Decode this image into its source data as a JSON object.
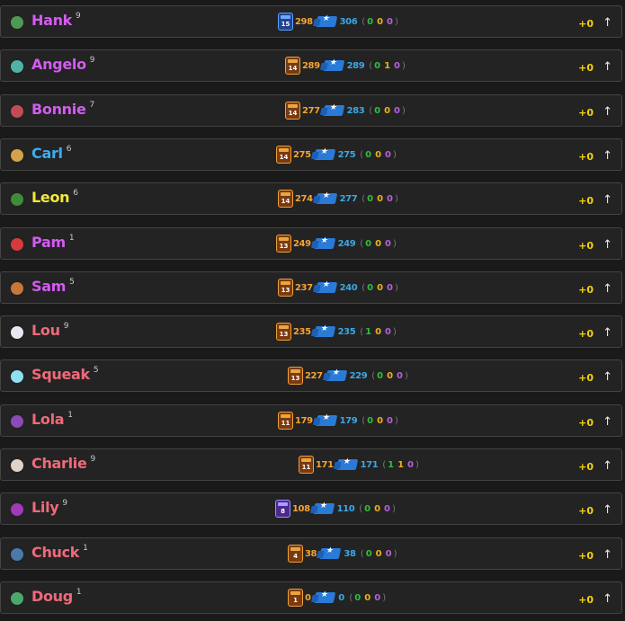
{
  "gain_color": "#f4d20a",
  "paren_colors": [
    "#2fbf3c",
    "#e8b21a",
    "#b660e0"
  ],
  "arrow_icon": "↑",
  "brawlers": [
    {
      "name": "Hank",
      "level": "9",
      "name_color": "#d25cf0",
      "avatar_color": "#4e9a55",
      "rank": "15",
      "trophies": "298",
      "max_trophies": "306",
      "stats": [
        "0",
        "0",
        "0"
      ],
      "gain": "+0"
    },
    {
      "name": "Angelo",
      "level": "9",
      "name_color": "#d25cf0",
      "avatar_color": "#4fb3a6",
      "rank": "14",
      "trophies": "289",
      "max_trophies": "289",
      "stats": [
        "0",
        "1",
        "0"
      ],
      "gain": "+0"
    },
    {
      "name": "Bonnie",
      "level": "7",
      "name_color": "#d25cf0",
      "avatar_color": "#c24b5a",
      "rank": "14",
      "trophies": "277",
      "max_trophies": "283",
      "stats": [
        "0",
        "0",
        "0"
      ],
      "gain": "+0"
    },
    {
      "name": "Carl",
      "level": "6",
      "name_color": "#3aaef0",
      "avatar_color": "#d3a24a",
      "rank": "14",
      "trophies": "275",
      "max_trophies": "275",
      "stats": [
        "0",
        "0",
        "0"
      ],
      "gain": "+0"
    },
    {
      "name": "Leon",
      "level": "6",
      "name_color": "#f0e83a",
      "avatar_color": "#3e8c3a",
      "rank": "14",
      "trophies": "274",
      "max_trophies": "277",
      "stats": [
        "0",
        "0",
        "0"
      ],
      "gain": "+0"
    },
    {
      "name": "Pam",
      "level": "1",
      "name_color": "#d25cf0",
      "avatar_color": "#d63a3a",
      "rank": "13",
      "trophies": "249",
      "max_trophies": "249",
      "stats": [
        "0",
        "0",
        "0"
      ],
      "gain": "+0"
    },
    {
      "name": "Sam",
      "level": "5",
      "name_color": "#d25cf0",
      "avatar_color": "#c8763a",
      "rank": "13",
      "trophies": "237",
      "max_trophies": "240",
      "stats": [
        "0",
        "0",
        "0"
      ],
      "gain": "+0"
    },
    {
      "name": "Lou",
      "level": "9",
      "name_color": "#f06a7a",
      "avatar_color": "#e8e8f0",
      "rank": "13",
      "trophies": "235",
      "max_trophies": "235",
      "stats": [
        "1",
        "0",
        "0"
      ],
      "gain": "+0"
    },
    {
      "name": "Squeak",
      "level": "5",
      "name_color": "#f06a7a",
      "avatar_color": "#8ee0f0",
      "rank": "13",
      "trophies": "227",
      "max_trophies": "229",
      "stats": [
        "0",
        "0",
        "0"
      ],
      "gain": "+0"
    },
    {
      "name": "Lola",
      "level": "1",
      "name_color": "#f06a7a",
      "avatar_color": "#8a4ab8",
      "rank": "11",
      "trophies": "179",
      "max_trophies": "179",
      "stats": [
        "0",
        "0",
        "0"
      ],
      "gain": "+0"
    },
    {
      "name": "Charlie",
      "level": "9",
      "name_color": "#f06a7a",
      "avatar_color": "#e0d4c8",
      "rank": "11",
      "trophies": "171",
      "max_trophies": "171",
      "stats": [
        "1",
        "1",
        "0"
      ],
      "gain": "+0"
    },
    {
      "name": "Lily",
      "level": "9",
      "name_color": "#f06a7a",
      "avatar_color": "#a03ab8",
      "rank": "8",
      "trophies": "108",
      "max_trophies": "110",
      "stats": [
        "0",
        "0",
        "0"
      ],
      "gain": "+0"
    },
    {
      "name": "Chuck",
      "level": "1",
      "name_color": "#f06a7a",
      "avatar_color": "#4a7aa8",
      "rank": "4",
      "trophies": "38",
      "max_trophies": "38",
      "stats": [
        "0",
        "0",
        "0"
      ],
      "gain": "+0"
    },
    {
      "name": "Doug",
      "level": "1",
      "name_color": "#f06a7a",
      "avatar_color": "#4aa86a",
      "rank": "1",
      "trophies": "0",
      "max_trophies": "0",
      "stats": [
        "0",
        "0",
        "0"
      ],
      "gain": "+0"
    }
  ]
}
